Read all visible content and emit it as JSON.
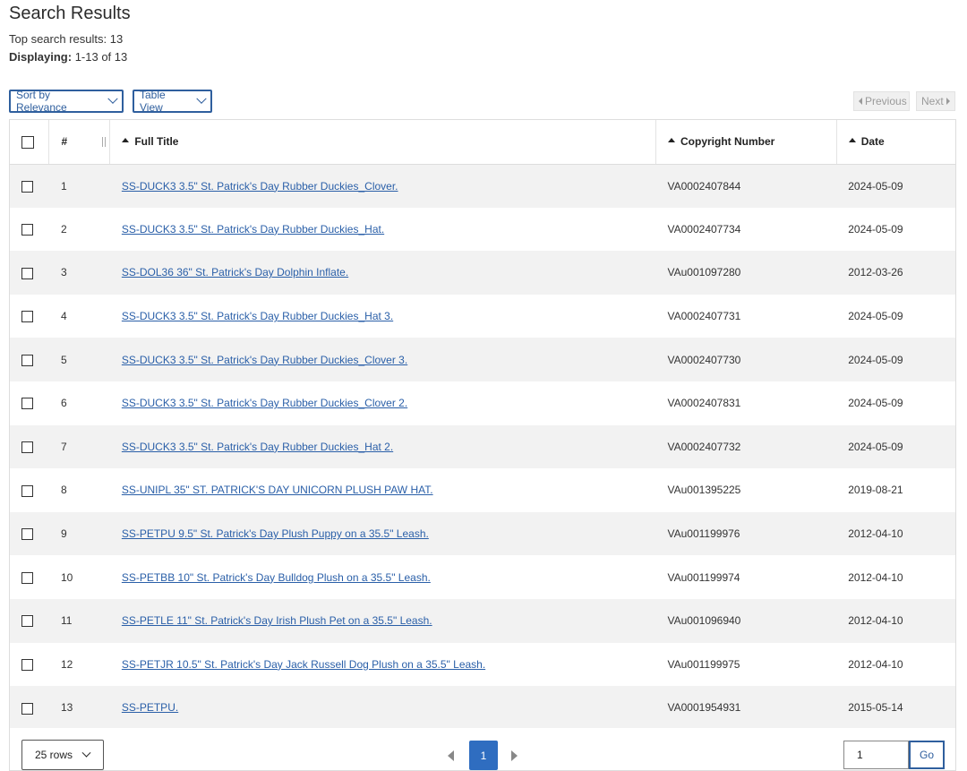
{
  "page": {
    "title": "Search Results",
    "top_results": "Top search results: 13",
    "displaying_label": "Displaying:",
    "displaying_value": " 1-13 of 13"
  },
  "controls": {
    "sort_label": "Sort by Relevance",
    "view_label": "Table View",
    "previous_label": "Previous",
    "next_label": "Next"
  },
  "table": {
    "headers": {
      "num": "#",
      "full_title": "Full Title",
      "copyright_number": "Copyright Number",
      "date": "Date"
    },
    "rows": [
      {
        "num": "1",
        "title": "SS-DUCK3 3.5\" St. Patrick's Day Rubber Duckies_Clover.",
        "copyright": "VA0002407844",
        "date": "2024-05-09"
      },
      {
        "num": "2",
        "title": "SS-DUCK3 3.5\" St. Patrick's Day Rubber Duckies_Hat.",
        "copyright": "VA0002407734",
        "date": "2024-05-09"
      },
      {
        "num": "3",
        "title": "SS-DOL36 36\" St. Patrick's Day Dolphin Inflate.",
        "copyright": "VAu001097280",
        "date": "2012-03-26"
      },
      {
        "num": "4",
        "title": "SS-DUCK3 3.5\" St. Patrick's Day Rubber Duckies_Hat 3.",
        "copyright": "VA0002407731",
        "date": "2024-05-09"
      },
      {
        "num": "5",
        "title": "SS-DUCK3 3.5\" St. Patrick's Day Rubber Duckies_Clover 3.",
        "copyright": "VA0002407730",
        "date": "2024-05-09"
      },
      {
        "num": "6",
        "title": "SS-DUCK3 3.5\" St. Patrick's Day Rubber Duckies_Clover 2.",
        "copyright": "VA0002407831",
        "date": "2024-05-09"
      },
      {
        "num": "7",
        "title": "SS-DUCK3 3.5\" St. Patrick's Day Rubber Duckies_Hat 2.",
        "copyright": "VA0002407732",
        "date": "2024-05-09"
      },
      {
        "num": "8",
        "title": "SS-UNIPL 35\" ST. PATRICK'S DAY UNICORN PLUSH PAW HAT.",
        "copyright": "VAu001395225",
        "date": "2019-08-21"
      },
      {
        "num": "9",
        "title": "SS-PETPU 9.5\" St. Patrick's Day Plush Puppy on a 35.5\" Leash.",
        "copyright": "VAu001199976",
        "date": "2012-04-10"
      },
      {
        "num": "10",
        "title": "SS-PETBB 10\" St. Patrick's Day Bulldog Plush on a 35.5\" Leash.",
        "copyright": "VAu001199974",
        "date": "2012-04-10"
      },
      {
        "num": "11",
        "title": "SS-PETLE 11\" St. Patrick's Day Irish Plush Pet on a 35.5\" Leash.",
        "copyright": "VAu001096940",
        "date": "2012-04-10"
      },
      {
        "num": "12",
        "title": "SS-PETJR 10.5\" St. Patrick's Day Jack Russell Dog Plush on a 35.5\" Leash.",
        "copyright": "VAu001199975",
        "date": "2012-04-10"
      },
      {
        "num": "13",
        "title": "SS-PETPU.",
        "copyright": "VA0001954931",
        "date": "2015-05-14"
      }
    ]
  },
  "footer": {
    "rows_label": "25 rows",
    "current_page": "1",
    "goto_value": "1",
    "go_label": "Go"
  },
  "colors": {
    "accent": "#2f5f9e",
    "link": "#2a5fa8",
    "page_active": "#2f6dc0",
    "row_stripe": "#f2f2f2"
  }
}
